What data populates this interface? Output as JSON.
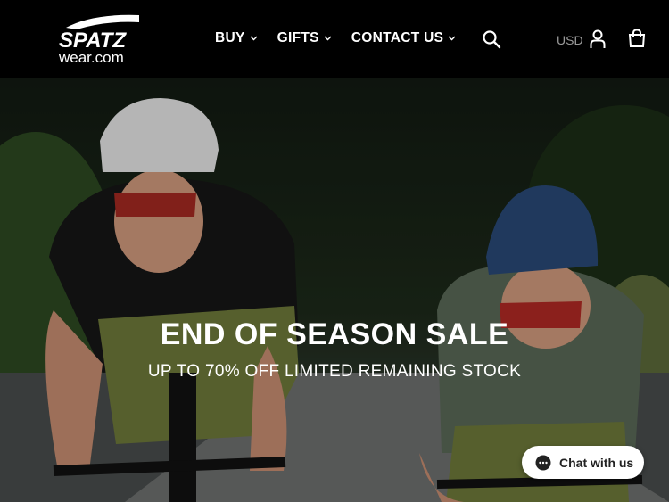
{
  "brand": {
    "logo_line1": "SPATZ",
    "logo_line2": "wear.com"
  },
  "nav": [
    {
      "label": "BUY",
      "icon": "chevron-down-icon"
    },
    {
      "label": "GIFTS",
      "icon": "chevron-down-icon"
    },
    {
      "label": "CONTACT US",
      "icon": "chevron-down-icon"
    }
  ],
  "header": {
    "currency": "USD",
    "search_icon": "search-icon",
    "account_icon": "user-icon",
    "cart_icon": "cart-icon"
  },
  "hero": {
    "title": "END OF SEASON SALE",
    "subtitle": "UP TO 70% OFF LIMITED REMAINING STOCK"
  },
  "chat": {
    "label": "Chat with us",
    "icon": "chat-bubble-icon"
  },
  "colors": {
    "header_bg": "#000000",
    "text": "#ffffff",
    "chat_bg": "#ffffff"
  }
}
